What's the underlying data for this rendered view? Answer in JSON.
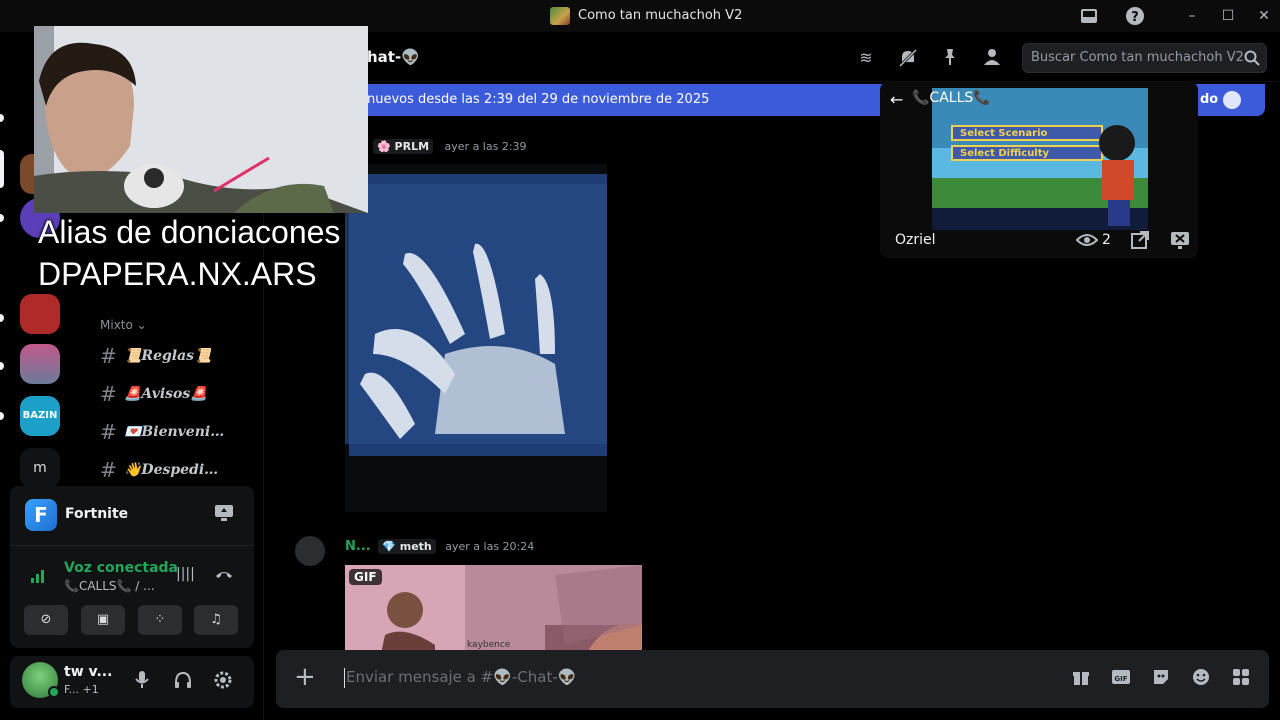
{
  "window": {
    "title": "Como tan muchachoh V2"
  },
  "overlay": {
    "line1": "Alias de donciacones",
    "line2": "DPAPERA.NX.ARS"
  },
  "rail": {
    "dm_letter": "m",
    "bazin_label": "BAZIN"
  },
  "sidebar": {
    "category": "Mixto",
    "channels": [
      {
        "label": "📜Reglas📜"
      },
      {
        "label": "🚨Avisos🚨"
      },
      {
        "label": "💌Bienveni…"
      },
      {
        "label": "👋Despedi…"
      }
    ]
  },
  "activity": {
    "game": "Fortnite",
    "icon_letter": "F"
  },
  "voice": {
    "status": "Voz conectada",
    "channel": "📞CALLS📞 / ..."
  },
  "user": {
    "name": "tw v...",
    "status": "F... +1"
  },
  "header": {
    "channel_name": "hat-👽",
    "search_placeholder": "Buscar Como tan muchachoh V2"
  },
  "new_messages_bar": {
    "text": "nuevos desde las 2:39 del 29 de noviembre de 2025",
    "right_text": "do"
  },
  "messages": [
    {
      "role": "PRLM",
      "time": "ayer a las 2:39"
    },
    {
      "author": "N...",
      "role": "meth",
      "time": "ayer a las 20:24",
      "gif_label": "GIF",
      "gif_caption": "kaybence"
    }
  ],
  "composer": {
    "placeholder": "Enviar mensaje a #👽-Chat-👽"
  },
  "popout": {
    "title": "📞CALLS📞",
    "user": "Ozriel",
    "viewers": "2",
    "game_lines": [
      "Select Scenario",
      "Select Difficulty"
    ]
  },
  "colors": {
    "accent": "#3b5bdb",
    "online": "#23a55a",
    "background": "#000000"
  }
}
